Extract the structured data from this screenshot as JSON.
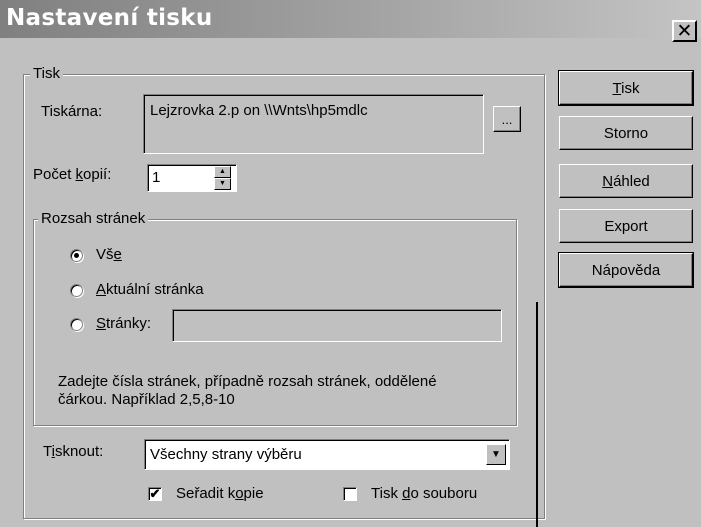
{
  "window": {
    "title": "Nastavení tisku",
    "close_glyph": "✕"
  },
  "tisk_group": {
    "legend": "Tisk",
    "printer_label": "Tiskárna:",
    "printer_value": "Lejzrovka 2.p on \\\\Wnts\\hp5mdlc",
    "browse_label": "...",
    "copies_label_pre": "Počet ",
    "copies_label_u": "k",
    "copies_label_post": "opií:",
    "copies_value": "1",
    "spin_up_glyph": "▲",
    "spin_down_glyph": "▼"
  },
  "range_group": {
    "legend": "Rozsah stránek",
    "all": {
      "pre": "Vš",
      "u": "e",
      "post": "",
      "checked": true
    },
    "current": {
      "pre": "",
      "u": "A",
      "post": "ktuální stránka",
      "checked": false
    },
    "pages": {
      "pre": "",
      "u": "S",
      "post": "tránky:",
      "checked": false,
      "value": ""
    },
    "hint_line1": "Zadejte čísla stránek, případně rozsah stránek, oddělené",
    "hint_line2": "čárkou. Například 2,5,8-10"
  },
  "print_what": {
    "label_pre": "T",
    "label_u": "i",
    "label_post": "sknout:",
    "value": "Všechny strany výběru",
    "arrow_glyph": "▼"
  },
  "options": {
    "collate": {
      "pre": "Seřadit k",
      "u": "o",
      "post": "pie",
      "checked": true,
      "glyph": "✔"
    },
    "to_file": {
      "pre": "Tisk ",
      "u": "d",
      "post": "o souboru",
      "checked": false,
      "glyph": ""
    }
  },
  "buttons": {
    "print": {
      "u": "T",
      "post": "isk"
    },
    "cancel": {
      "label": "Storno"
    },
    "preview": {
      "u": "N",
      "post": "áhled"
    },
    "export": {
      "label": "Export"
    },
    "help": {
      "label": "Nápověda"
    }
  }
}
